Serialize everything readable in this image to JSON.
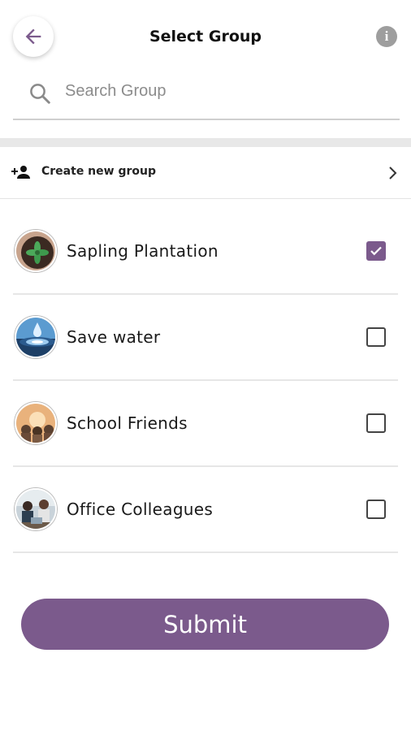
{
  "header": {
    "title": "Select Group",
    "back_icon": "arrow-left-icon",
    "info_icon": "info-icon",
    "info_glyph": "i"
  },
  "search": {
    "placeholder": "Search Group",
    "value": ""
  },
  "create_group": {
    "label": "Create new group",
    "icon": "person-add-icon"
  },
  "groups": [
    {
      "name": "Sapling Plantation",
      "checked": true
    },
    {
      "name": "Save water",
      "checked": false
    },
    {
      "name": "School Friends",
      "checked": false
    },
    {
      "name": "Office Colleagues",
      "checked": false
    }
  ],
  "submit_label": "Submit",
  "colors": {
    "accent": "#7b5a8c",
    "divider": "#e6e6e6",
    "band": "#e8e8e8"
  }
}
